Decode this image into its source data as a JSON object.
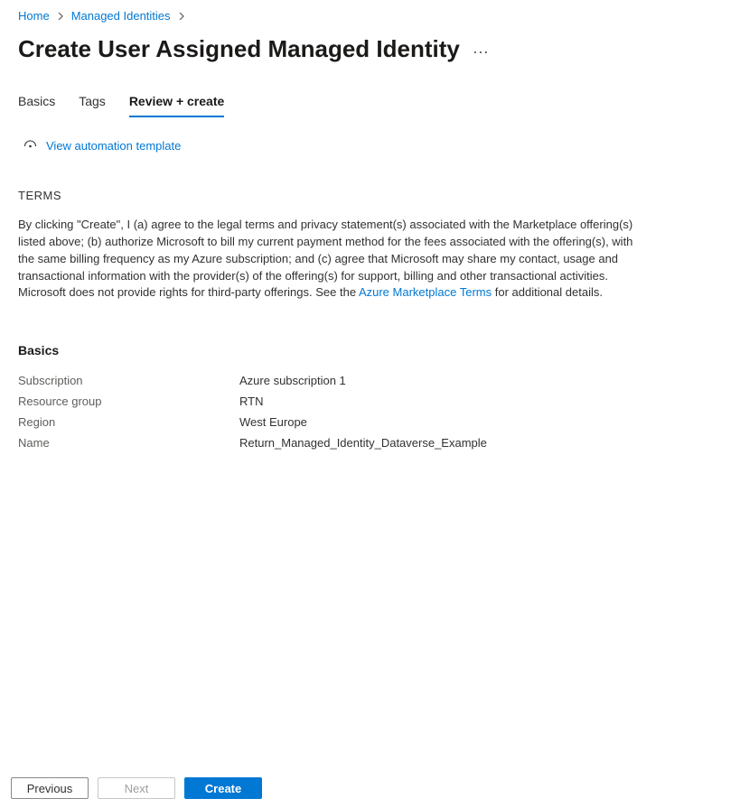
{
  "breadcrumb": {
    "home": "Home",
    "managed_identities": "Managed Identities"
  },
  "page_title": "Create User Assigned Managed Identity",
  "tabs": {
    "basics": "Basics",
    "tags": "Tags",
    "review": "Review + create"
  },
  "view_template_link": "View automation template",
  "terms": {
    "heading": "TERMS",
    "body_before_link": "By clicking \"Create\", I (a) agree to the legal terms and privacy statement(s) associated with the Marketplace offering(s) listed above; (b) authorize Microsoft to bill my current payment method for the fees associated with the offering(s), with the same billing frequency as my Azure subscription; and (c) agree that Microsoft may share my contact, usage and transactional information with the provider(s) of the offering(s) for support, billing and other transactional activities. Microsoft does not provide rights for third-party offerings. See the ",
    "link_text": "Azure Marketplace Terms",
    "body_after_link": " for additional details."
  },
  "basics": {
    "heading": "Basics",
    "subscription_label": "Subscription",
    "subscription_value": "Azure subscription 1",
    "resource_group_label": "Resource group",
    "resource_group_value": "RTN",
    "region_label": "Region",
    "region_value": "West Europe",
    "name_label": "Name",
    "name_value": "Return_Managed_Identity_Dataverse_Example"
  },
  "footer": {
    "previous": "Previous",
    "next": "Next",
    "create": "Create"
  }
}
